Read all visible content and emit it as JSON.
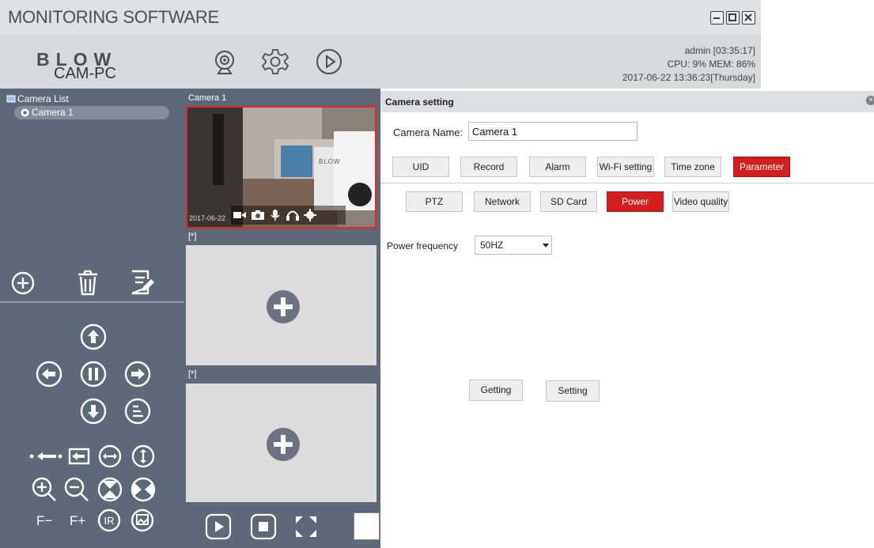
{
  "window": {
    "title": "MONITORING SOFTWARE",
    "controls": [
      "minimize-icon",
      "maximize-icon",
      "close-icon"
    ]
  },
  "header": {
    "logo_text": "BLOW",
    "pc_name": "CAM-PC",
    "nav_icons": [
      "camera-icon",
      "gear-icon",
      "play-icon"
    ],
    "status": {
      "user": "admin  [03:35:17]",
      "resources": "CPU: 9%  MEM: 86%",
      "datetime": "2017-06-22 13:36:23[Thursday]"
    }
  },
  "sidebar": {
    "camera_list_label": "Camera List",
    "cameras": [
      {
        "label": "Camera 1"
      }
    ],
    "list_actions": [
      "add-icon",
      "delete-icon",
      "edit-icon"
    ],
    "ptz_controls": [
      "up-icon",
      "left-icon",
      "pause-icon",
      "right-icon",
      "down-icon",
      "menu-icon"
    ],
    "lens_controls": [
      "focus-in-icon",
      "focus-out-icon",
      "horizontal-icon",
      "vertical-icon"
    ],
    "zoom_controls": [
      "zoom-in-icon",
      "zoom-out-icon",
      "flip-icon",
      "mirror-icon"
    ],
    "focus_minus": "F−",
    "focus_plus": "F+",
    "ir_icon": "ir-icon",
    "image_icon": "image-icon"
  },
  "views": {
    "slot1_label": "Camera 1",
    "slot1_timestamp": "2017-06-22",
    "slot1_brand": "BLOW",
    "slot2_label": "[*]",
    "slot3_label": "[*]",
    "bottom_controls": [
      "play-icon",
      "stop-icon",
      "fullscreen-icon"
    ],
    "accent": "#e02a2a"
  },
  "settings": {
    "title": "Camera setting",
    "camera_name_label": "Camera Name:",
    "camera_name_value": "Camera 1",
    "tabs": [
      "UID",
      "Record",
      "Alarm",
      "Wi-Fi setting",
      "Time zone",
      "Parameter"
    ],
    "active_tab": "Parameter",
    "subtabs": [
      "PTZ",
      "Network",
      "SD Card",
      "Power",
      "Video quality"
    ],
    "active_subtab": "Power",
    "power_frequency_label": "Power frequency",
    "power_frequency_value": "50HZ",
    "getting_label": "Getting",
    "setting_label": "Setting",
    "active_color": "#d31f1f"
  }
}
